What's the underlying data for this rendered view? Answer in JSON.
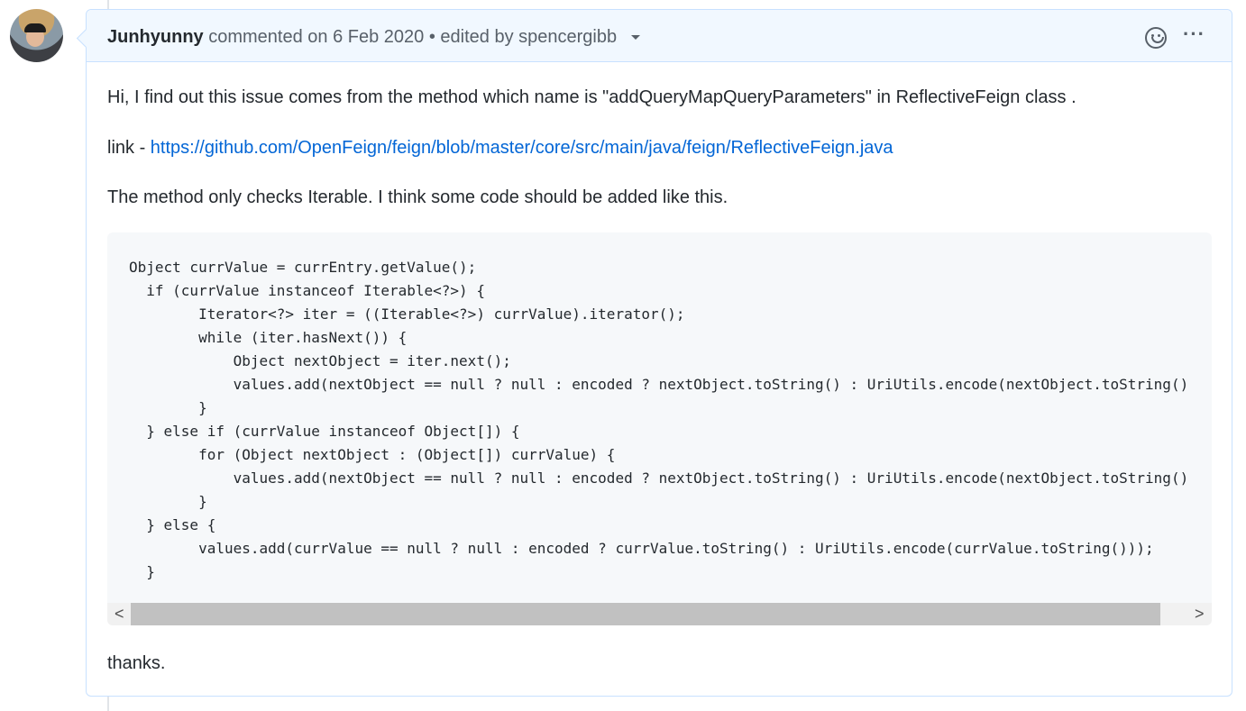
{
  "comment": {
    "author": "Junhyunny",
    "meta": "commented on 6 Feb 2020 • edited by spencergibb",
    "paragraphs": [
      "Hi, I find out this issue comes from the method which name is \"addQueryMapQueryParameters\" in ReflectiveFeign class .",
      "The method only checks Iterable. I think some code should be added like this."
    ],
    "link_prefix": "link - ",
    "link_text": "https://github.com/OpenFeign/feign/blob/master/core/src/main/java/feign/ReflectiveFeign.java",
    "code": "Object currValue = currEntry.getValue();\n  if (currValue instanceof Iterable<?>) {\n        Iterator<?> iter = ((Iterable<?>) currValue).iterator();\n        while (iter.hasNext()) {\n            Object nextObject = iter.next();\n            values.add(nextObject == null ? null : encoded ? nextObject.toString() : UriUtils.encode(nextObject.toString()\n        }\n  } else if (currValue instanceof Object[]) {\n        for (Object nextObject : (Object[]) currValue) {\n            values.add(nextObject == null ? null : encoded ? nextObject.toString() : UriUtils.encode(nextObject.toString()\n        }\n  } else {\n        values.add(currValue == null ? null : encoded ? currValue.toString() : UriUtils.encode(currValue.toString()));\n  }",
    "closing": "thanks.",
    "scroll_left": "<",
    "scroll_right": ">",
    "more": "···"
  }
}
